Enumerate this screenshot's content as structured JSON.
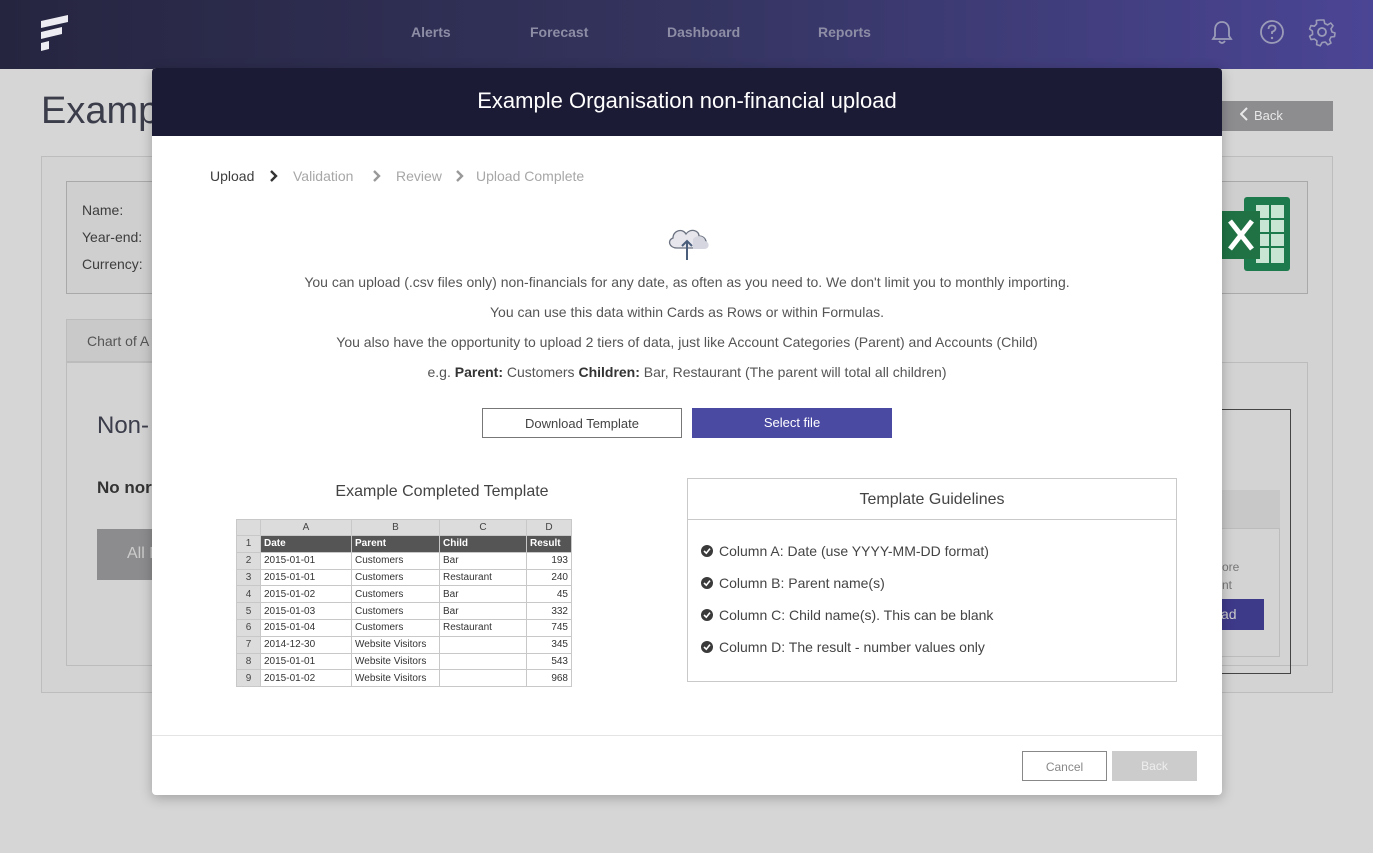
{
  "nav": {
    "items": [
      "Alerts",
      "Forecast",
      "Dashboard",
      "Reports"
    ],
    "icons": [
      "bell-icon",
      "help-icon",
      "gear-icon"
    ]
  },
  "background": {
    "page_title": "Examp",
    "back_button": "Back",
    "info": {
      "name": "Name:",
      "year_end": "Year-end:",
      "currency": "Currency:"
    },
    "tab": "Chart of A",
    "heading": "Non-",
    "subheading": "No nor",
    "button": "All N",
    "card_text_1": "ore",
    "card_text_2": "nt",
    "card_button": "ad"
  },
  "modal": {
    "title": "Example Organisation non-financial upload",
    "steps": [
      "Upload",
      "Validation",
      "Review",
      "Upload Complete"
    ],
    "active_step": "Upload",
    "lines": [
      "You can upload (.csv files only) non-financials for any date, as often as you need to. We don't limit you to monthly importing.",
      "You can use this data within Cards as Rows or within Formulas.",
      "You also have the opportunity to upload 2 tiers of data, just like Account Categories (Parent) and Accounts (Child)"
    ],
    "example": {
      "prefix": "e.g.",
      "parent_label": "Parent:",
      "parent_value": "Customers",
      "children_label": "Children:",
      "children_value": "Bar, Restaurant (The parent will total all children)"
    },
    "download_button": "Download Template",
    "select_button": "Select file",
    "example_title": "Example Completed Template",
    "sheet": {
      "columns": [
        "A",
        "B",
        "C",
        "D"
      ],
      "header": [
        "Date",
        "Parent",
        "Child",
        "Result"
      ],
      "rows": [
        [
          "2015-01-01",
          "Customers",
          "Bar",
          "193"
        ],
        [
          "2015-01-01",
          "Customers",
          "Restaurant",
          "240"
        ],
        [
          "2015-01-02",
          "Customers",
          "Bar",
          "45"
        ],
        [
          "2015-01-03",
          "Customers",
          "Bar",
          "332"
        ],
        [
          "2015-01-04",
          "Customers",
          "Restaurant",
          "745"
        ],
        [
          "2014-12-30",
          "Website Visitors",
          "",
          "345"
        ],
        [
          "2015-01-01",
          "Website Visitors",
          "",
          "543"
        ],
        [
          "2015-01-02",
          "Website Visitors",
          "",
          "968"
        ]
      ]
    },
    "guidelines": {
      "title": "Template Guidelines",
      "items": [
        "Column A: Date (use YYYY-MM-DD format)",
        "Column B: Parent name(s)",
        "Column C: Child name(s). This can be blank",
        "Column D: The result - number values only"
      ]
    },
    "cancel_button": "Cancel",
    "back_button": "Back"
  },
  "colors": {
    "accent": "#4b4aa3",
    "header": "#1c1b35"
  }
}
